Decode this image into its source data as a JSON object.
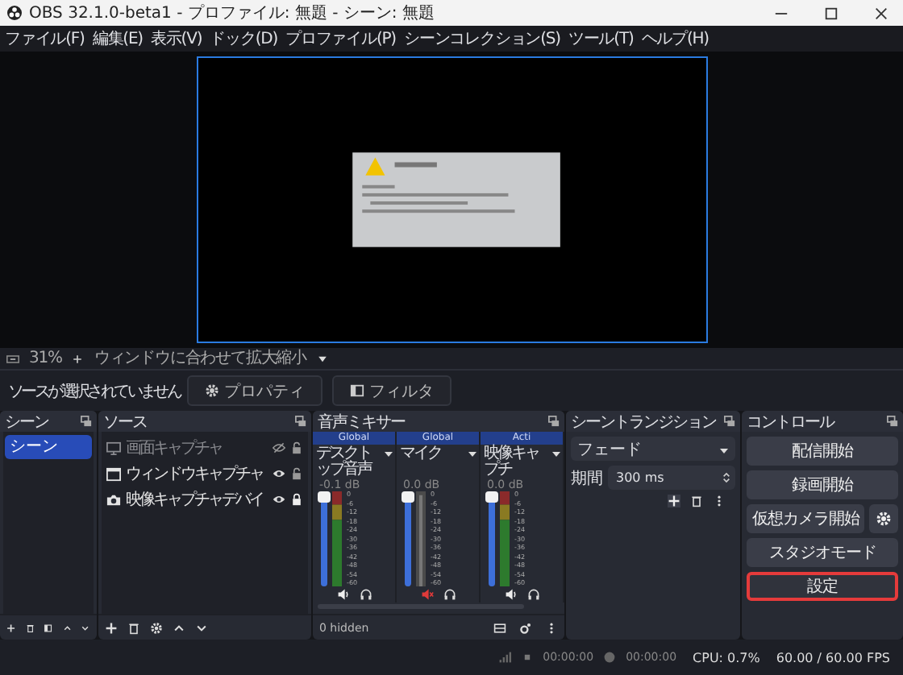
{
  "window": {
    "title": "OBS 32.1.0-beta1 - プロファイル: 無題 - シーン: 無題"
  },
  "menu": [
    "ファイル(F)",
    "編集(E)",
    "表示(V)",
    "ドック(D)",
    "プロファイル(P)",
    "シーンコレクション(S)",
    "ツール(T)",
    "ヘルプ(H)"
  ],
  "zoom_bar": {
    "zoom": "31%",
    "fit_label": "ウィンドウに合わせて拡大縮小"
  },
  "source_bar": {
    "status": "ソースが選択されていません",
    "properties": "プロパティ",
    "filters": "フィルタ"
  },
  "scenes": {
    "title": "シーン",
    "items": [
      {
        "name": "シーン",
        "selected": true
      }
    ]
  },
  "sources": {
    "title": "ソース",
    "items": [
      {
        "name": "画面キャプチャ",
        "kind": "display",
        "visible": false,
        "locked": false
      },
      {
        "name": "ウィンドウキャプチャ",
        "kind": "window",
        "visible": true,
        "locked": false
      },
      {
        "name": "映像キャプチャデバイ",
        "kind": "camera",
        "visible": true,
        "locked": true
      }
    ]
  },
  "mixer": {
    "title": "音声ミキサー",
    "hidden": "0 hidden",
    "channels": [
      {
        "tag": "Global",
        "name": "デスクトップ音声",
        "db": "-0.1 dB",
        "level": 1,
        "muted": false,
        "ticks": [
          "0",
          "-6",
          "-12",
          "-18",
          "-24",
          "-30",
          "-36",
          "-42",
          "-48",
          "-54",
          "-60"
        ]
      },
      {
        "tag": "Global",
        "name": "マイク",
        "db": "0.0 dB",
        "level": 1,
        "muted": true,
        "ticks": [
          "0",
          "-6",
          "-12",
          "-18",
          "-24",
          "-30",
          "-36",
          "-42",
          "-48",
          "-54",
          "-60"
        ]
      },
      {
        "tag": "Acti",
        "name": "映像キャプチ",
        "db": "0.0 dB",
        "level": 1,
        "muted": false,
        "ticks": [
          "0",
          "-6",
          "-12",
          "-18",
          "-24",
          "-30",
          "-36",
          "-42",
          "-48",
          "-54",
          "-60"
        ]
      }
    ]
  },
  "transition": {
    "title": "シーントランジション",
    "type": "フェード",
    "duration_label": "期間",
    "duration": "300 ms"
  },
  "controls": {
    "title": "コントロール",
    "buttons": [
      {
        "label": "配信開始",
        "highlighted": false,
        "settings": false
      },
      {
        "label": "録画開始",
        "highlighted": false,
        "settings": false
      },
      {
        "label": "仮想カメラ開始",
        "highlighted": false,
        "settings": true
      },
      {
        "label": "スタジオモード",
        "highlighted": false,
        "settings": false
      },
      {
        "label": "設定",
        "highlighted": true,
        "settings": false
      }
    ]
  },
  "status_bar": {
    "stream_time": "00:00:00",
    "record_time": "00:00:00",
    "cpu": "CPU: 0.7%",
    "fps": "60.00 / 60.00 FPS"
  }
}
